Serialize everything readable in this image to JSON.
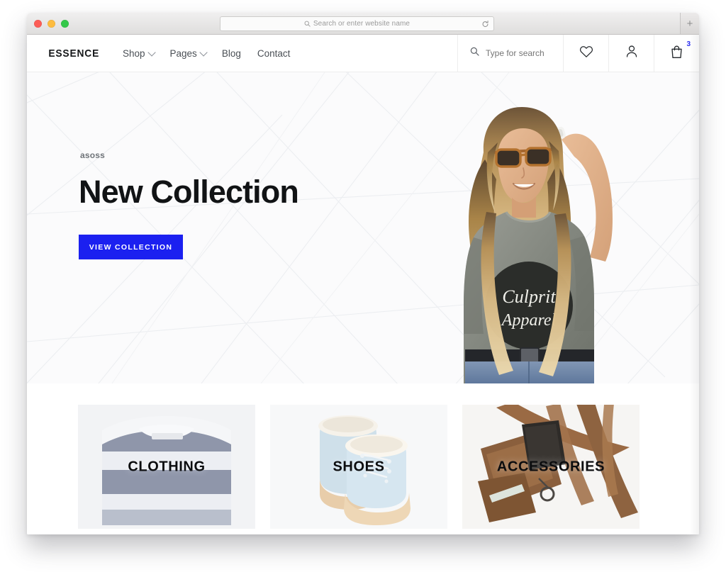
{
  "browser": {
    "url_placeholder": "Search or enter website name",
    "search_icon": "search-icon",
    "reload_icon": "reload-icon",
    "newtab_label": "+",
    "traffic_lights": [
      "close",
      "minimize",
      "zoom"
    ]
  },
  "site": {
    "brand": "ESSENCE",
    "nav": [
      {
        "label": "Shop",
        "has_dropdown": true
      },
      {
        "label": "Pages",
        "has_dropdown": true
      },
      {
        "label": "Blog",
        "has_dropdown": false
      },
      {
        "label": "Contact",
        "has_dropdown": false
      }
    ],
    "tools": {
      "search_placeholder": "Type for search",
      "search_value": "",
      "wishlist_icon": "heart-icon",
      "account_icon": "user-icon",
      "cart_icon": "shopping-bag-icon",
      "cart_count": "3",
      "cart_badge_color": "#2a2ef0"
    }
  },
  "hero": {
    "eyebrow": "asoss",
    "title": "New Collection",
    "cta_label": "VIEW COLLECTION",
    "cta_color": "#1b20f0",
    "model_alt": "woman-in-sunglasses-grey-tshirt",
    "tshirt_text_line1": "Culprit",
    "tshirt_text_line2": "Apparel"
  },
  "categories": [
    {
      "label": "CLOTHING",
      "media": "folded-grey-striped-sweater"
    },
    {
      "label": "SHOES",
      "media": "light-blue-winter-boots"
    },
    {
      "label": "ACCESSORIES",
      "media": "brown-leather-bag-accessories"
    }
  ]
}
